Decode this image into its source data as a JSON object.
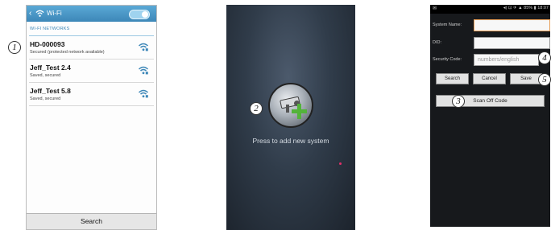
{
  "wifi_screen": {
    "title": "Wi-Fi",
    "back_glyph": "‹",
    "toggle_on": true,
    "section_label": "WI-FI NETWORKS",
    "networks": [
      {
        "name": "HD-000093",
        "status": "Secured (protected network available)",
        "icon": "wifi-signal-icon"
      },
      {
        "name": "Jeff_Test 2.4",
        "status": "Saved, secured",
        "icon": "wifi-signal-icon"
      },
      {
        "name": "Jeff_Test 5.8",
        "status": "Saved, secured",
        "icon": "wifi-signal-icon"
      }
    ],
    "search_label": "Search"
  },
  "add_screen": {
    "caption": "Press to add new system",
    "button_icon": "camera-plus-icon"
  },
  "form_screen": {
    "status_left": "✉",
    "status_right": "◂) ⊡ ✈ ▲ 85% ▮ 18:07",
    "system_name_label": "System Name:",
    "did_label": "DID:",
    "security_code_label": "Security Code:",
    "security_code_placeholder": "numbers/english",
    "search_label": "Search",
    "cancel_label": "Cancel",
    "save_label": "Save",
    "scan_label": "Scan Off Code"
  },
  "callouts": [
    "1",
    "2",
    "3",
    "4",
    "5"
  ],
  "colors": {
    "wifi_header": "#3d87b8",
    "add_plus": "#53b33a",
    "focus_border": "#e8a05a"
  }
}
